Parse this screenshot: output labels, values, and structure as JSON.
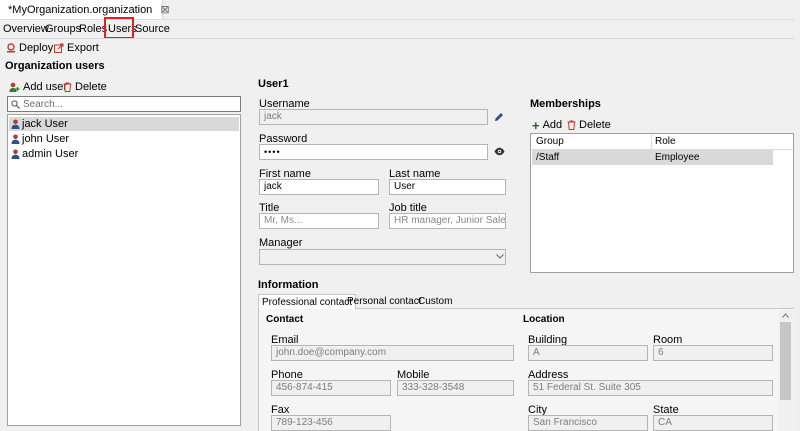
{
  "editor": {
    "tab_title": "*MyOrganization.organization",
    "close": "⊠"
  },
  "nav": {
    "overview": "Overview",
    "groups": "Groups",
    "roles": "Roles",
    "users": "Users",
    "source": "Source"
  },
  "toolbar": {
    "deploy": "Deploy",
    "export": "Export"
  },
  "left": {
    "title": "Organization users",
    "add_user": "Add user",
    "delete": "Delete",
    "search_placeholder": "Search...",
    "users": [
      "jack User",
      "john User",
      "admin User"
    ]
  },
  "form": {
    "section_title": "User1",
    "username_label": "Username",
    "username_value": "jack",
    "password_label": "Password",
    "password_value": "••••",
    "first_name_label": "First name",
    "first_name_value": "jack",
    "last_name_label": "Last name",
    "last_name_value": "User",
    "title_label": "Title",
    "title_placeholder": "Mr, Ms...",
    "job_title_label": "Job title",
    "job_title_placeholder": "HR manager, Junior Sales...",
    "manager_label": "Manager",
    "manager_value": ""
  },
  "memberships": {
    "title": "Memberships",
    "add": "Add",
    "delete": "Delete",
    "col_group": "Group",
    "col_role": "Role",
    "rows": [
      {
        "group": "/Staff",
        "role": "Employee"
      }
    ]
  },
  "information": {
    "title": "Information",
    "tabs": [
      "Professional contact",
      "Personal contact",
      "Custom"
    ],
    "contact_title": "Contact",
    "location_title": "Location",
    "email_label": "Email",
    "email_value": "john.doe@company.com",
    "phone_label": "Phone",
    "phone_value": "456-874-415",
    "mobile_label": "Mobile",
    "mobile_value": "333-328-3548",
    "fax_label": "Fax",
    "fax_value": "789-123-456",
    "building_label": "Building",
    "building_value": "A",
    "room_label": "Room",
    "room_value": "6",
    "address_label": "Address",
    "address_value": "51 Federal St. Suite 305",
    "city_label": "City",
    "city_value": "San Francisco",
    "state_label": "State",
    "state_value": "CA"
  },
  "colors": {
    "highlight_border": "#e02020",
    "selection": "#d9d9d9"
  }
}
